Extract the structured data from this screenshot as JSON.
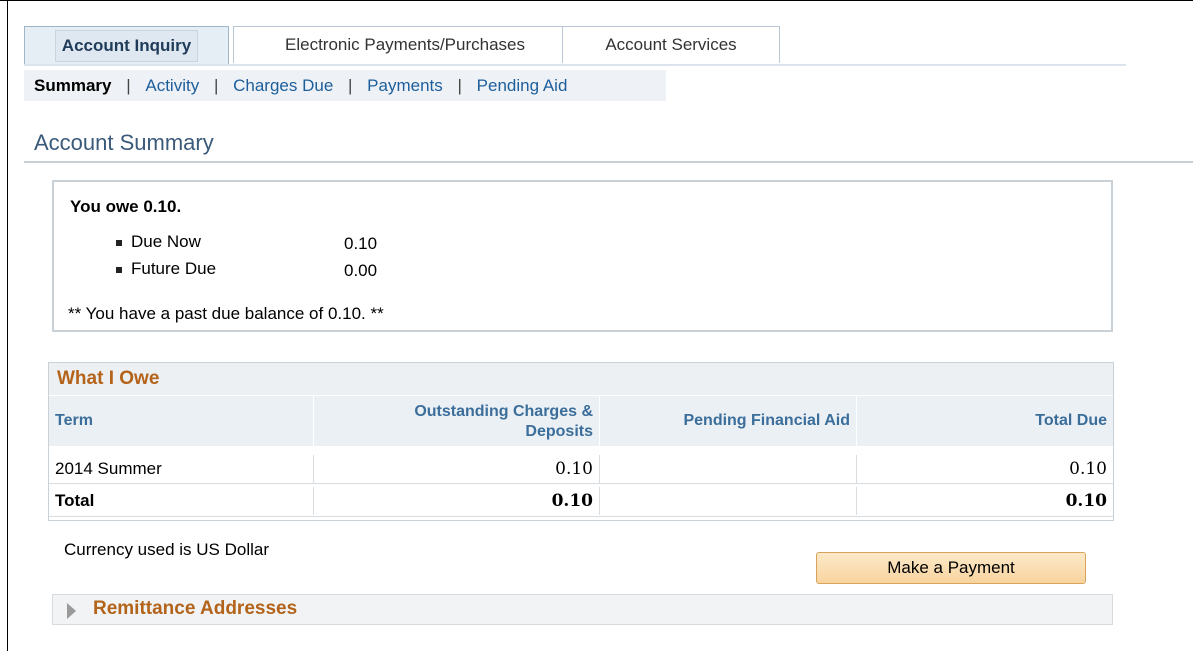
{
  "tabs": [
    {
      "label": "Account Inquiry"
    },
    {
      "label": "Electronic Payments/Purchases"
    },
    {
      "label": "Account Services"
    }
  ],
  "subnav": {
    "current": "Summary",
    "separator": "|",
    "links": [
      "Activity",
      "Charges Due",
      "Payments",
      "Pending Aid"
    ]
  },
  "page_title": "Account Summary",
  "owe": {
    "headline": "You owe 0.10.",
    "rows": [
      {
        "label": "Due Now",
        "value": "0.10"
      },
      {
        "label": "Future Due",
        "value": "0.00"
      }
    ],
    "past_due": "** You have a past due balance of 0.10. **"
  },
  "what_i_owe": {
    "title": "What I Owe",
    "columns": [
      "Term",
      "Outstanding Charges &",
      "Deposits",
      "Pending Financial Aid",
      "Total Due"
    ],
    "rows": [
      {
        "term": "2014 Summer",
        "charges": "0.10",
        "aid": "",
        "total": "0.10"
      },
      {
        "term": "Total",
        "charges": "0.10",
        "aid": "",
        "total": "0.10"
      }
    ]
  },
  "currency_note": "Currency used is US Dollar",
  "pay_button": "Make a Payment",
  "remittance": "Remittance Addresses"
}
